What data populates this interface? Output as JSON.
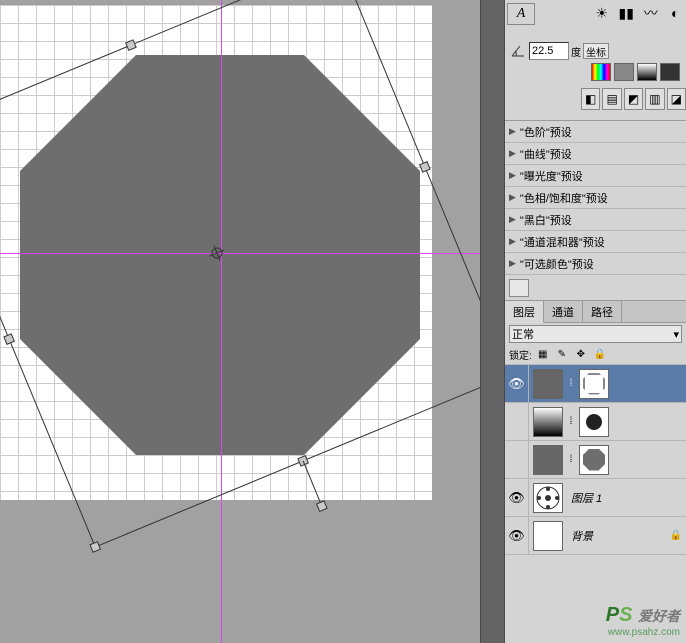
{
  "options": {
    "angle_value": "22.5",
    "angle_unit": "度",
    "coord_label": "坐标"
  },
  "char_panel": {
    "label": "A"
  },
  "presets": [
    {
      "label": "\"色阶\"预设"
    },
    {
      "label": "\"曲线\"预设"
    },
    {
      "label": "\"曝光度\"预设"
    },
    {
      "label": "\"色相/饱和度\"预设"
    },
    {
      "label": "\"黑白\"预设"
    },
    {
      "label": "\"通道混和器\"预设"
    },
    {
      "label": "\"可选颜色\"预设"
    }
  ],
  "tabs": {
    "layers": "图层",
    "channels": "通道",
    "paths": "路径"
  },
  "blend": {
    "mode": "正常"
  },
  "lock": {
    "label": "锁定:"
  },
  "layers": {
    "layer1_name": "图层 1",
    "bg_name": "背景"
  },
  "watermark": {
    "ps_p": "P",
    "ps_s": "S",
    "cn": "爱好者",
    "url": "www.psahz.com"
  }
}
